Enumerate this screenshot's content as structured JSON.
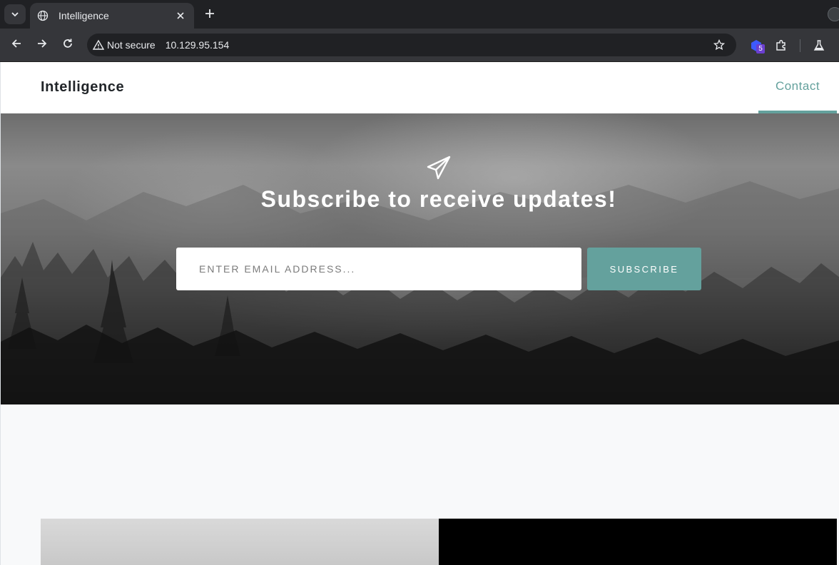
{
  "browser": {
    "tab": {
      "title": "Intelligence",
      "favicon": "globe-icon"
    },
    "omnibox": {
      "security_label": "Not secure",
      "url": "10.129.95.154"
    },
    "extensions_badge": "5"
  },
  "site": {
    "brand": "Intelligence",
    "nav": {
      "contact_label": "Contact"
    },
    "hero": {
      "icon": "paper-plane-icon",
      "title": "Subscribe to receive updates!",
      "email_placeholder": "ENTER EMAIL ADDRESS...",
      "subscribe_label": "SUBSCRIBE"
    }
  },
  "colors": {
    "accent": "#64a19d",
    "brand_text": "#212529",
    "chrome_dark": "#202124",
    "chrome_toolbar": "#35363a"
  }
}
